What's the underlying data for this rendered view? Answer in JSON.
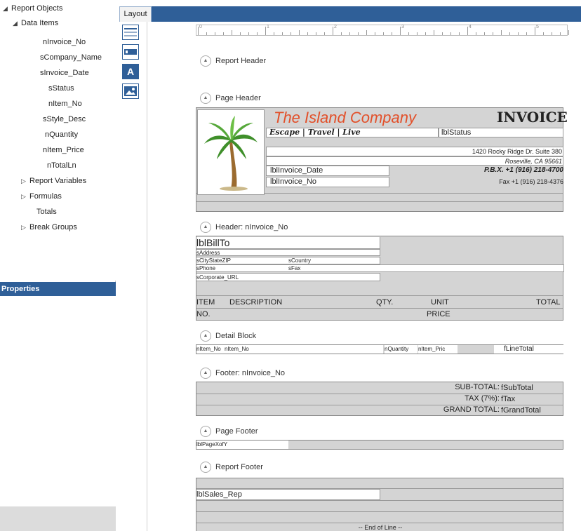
{
  "tree": {
    "root": "Report Objects",
    "data_items": "Data Items",
    "items": [
      "nInvoice_No",
      "sCompany_Name",
      "sInvoice_Date",
      "sStatus",
      "nItem_No",
      "sStyle_Desc",
      "nQuantity",
      "nItem_Price",
      "nTotalLn"
    ],
    "report_variables": "Report Variables",
    "formulas": "Formulas",
    "totals": "Totals",
    "break_groups": "Break Groups"
  },
  "properties": {
    "title": "Properties"
  },
  "tabs": {
    "layout": "Layout"
  },
  "toolbox": [
    "line-tool-icon",
    "rectangle-tool-icon",
    "text-tool-icon",
    "image-tool-icon"
  ],
  "ruler": {
    "labels": [
      "0",
      "1",
      "2",
      "3",
      "4",
      "5"
    ]
  },
  "sections": {
    "report_header": "Report Header",
    "page_header": "Page Header",
    "header_invoice": "Header: nInvoice_No",
    "detail": "Detail Block",
    "footer_invoice": "Footer: nInvoice_No",
    "page_footer": "Page Footer",
    "report_footer": "Report Footer"
  },
  "page_header": {
    "company": "The Island Company",
    "invoice": "INVOICE",
    "tagline": "Escape | Travel | Live",
    "status": "lblStatus",
    "address1": "1420 Rocky Ridge Dr. Suite 380",
    "address2": "Roseville, CA 95661",
    "phone": "P.B.X. +1 (916) 218-4700",
    "fax": "Fax +1 (916) 218-4376",
    "invoice_date": "lblInvoice_Date",
    "invoice_no": "lblInvoice_No"
  },
  "group_header": {
    "bill_to": "lblBillTo",
    "address": "sAddress",
    "city": "sCityStateZIP",
    "country": "sCountry",
    "phone": "sPhone",
    "fax": "sFax",
    "url": "sCorporate_URL",
    "col_item": "ITEM",
    "col_desc": "DESCRIPTION",
    "col_qty": "QTY.",
    "col_unit": "UNIT",
    "col_total": "TOTAL",
    "col_no": "NO.",
    "col_price": "PRICE"
  },
  "detail": {
    "item_no_1": "nItem_No",
    "item_no_2": "nItem_No",
    "quantity": "nQuantity",
    "price": "nItem_Pric",
    "line_total": "fLineTotal"
  },
  "footer": {
    "sub_label": "SUB-TOTAL:",
    "sub_val": "fSubTotal",
    "tax_label": "TAX (7%):",
    "tax_val": "fTax",
    "grand_label": "GRAND TOTAL:",
    "grand_val": "fGrandTotal"
  },
  "page_footer": {
    "page": "lblPageXofY"
  },
  "report_footer": {
    "sales_rep": "lblSales_Rep",
    "end": "-- End of Line --"
  },
  "colors": {
    "accent": "#2f5f98",
    "company": "#e2502a",
    "band": "#d4d4d4"
  }
}
